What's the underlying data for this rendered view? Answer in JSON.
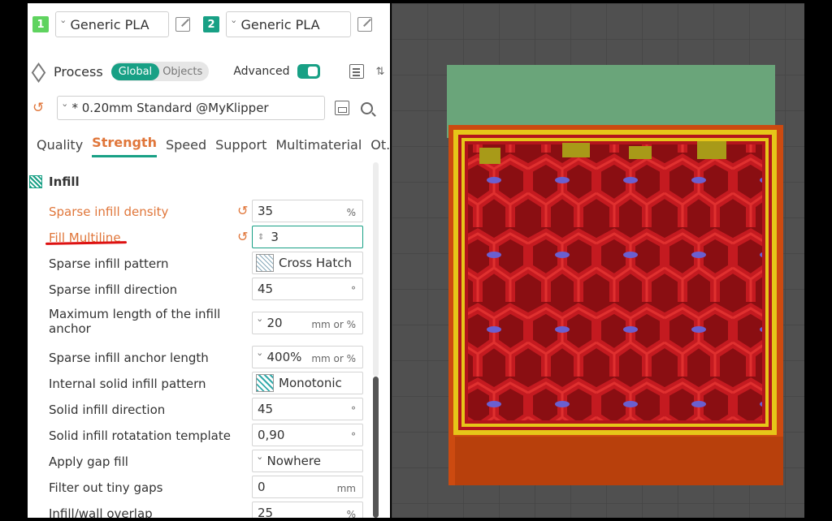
{
  "filaments": [
    {
      "index": "1",
      "name": "Generic PLA",
      "color": "#5fd35f"
    },
    {
      "index": "2",
      "name": "Generic PLA",
      "color": "#18a085"
    }
  ],
  "process": {
    "label": "Process",
    "mode_global": "Global",
    "mode_objects": "Objects",
    "advanced_label": "Advanced",
    "advanced_on": true
  },
  "preset": {
    "name": "* 0.20mm Standard @MyKlipper"
  },
  "tabs": [
    "Quality",
    "Strength",
    "Speed",
    "Support",
    "Multimaterial",
    "Ot..."
  ],
  "active_tab": "Strength",
  "section": {
    "title": "Infill"
  },
  "settings": [
    {
      "label": "Sparse infill density",
      "value": "35",
      "unit": "%",
      "modified": true
    },
    {
      "label": "Fill Multiline",
      "value": "3",
      "unit": "",
      "modified": true
    },
    {
      "label": "Sparse infill pattern",
      "value": "Cross Hatch",
      "unit": ""
    },
    {
      "label": "Sparse infill direction",
      "value": "45",
      "unit": "°"
    },
    {
      "label": "Maximum length of the infill anchor",
      "value": "20",
      "unit": "mm or %"
    },
    {
      "label": "Sparse infill anchor length",
      "value": "400%",
      "unit": "mm or %"
    },
    {
      "label": "Internal solid infill pattern",
      "value": "Monotonic",
      "unit": ""
    },
    {
      "label": "Solid infill direction",
      "value": "45",
      "unit": "°"
    },
    {
      "label": "Solid infill rotatation template",
      "value": "0,90",
      "unit": "°"
    },
    {
      "label": "Apply gap fill",
      "value": "Nowhere",
      "unit": ""
    },
    {
      "label": "Filter out tiny gaps",
      "value": "0",
      "unit": "mm"
    },
    {
      "label": "Infill/wall overlap",
      "value": "25",
      "unit": "%"
    }
  ],
  "colors": {
    "accent": "#18a085",
    "modified": "#e0763a",
    "model_infill": "#b3141c",
    "model_wall": "#e0c21a",
    "model_outer": "#cc4a10",
    "plate": "#6aa57a"
  }
}
